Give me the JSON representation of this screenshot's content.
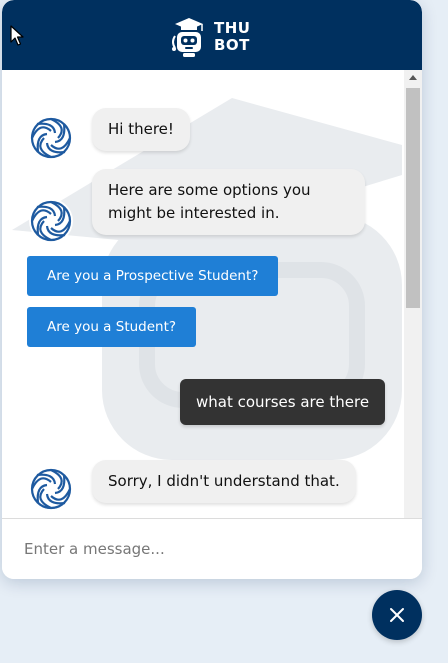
{
  "brand": {
    "logo_line1": "THU",
    "logo_line2": "BOT"
  },
  "messages": [
    {
      "sender": "bot",
      "text": "Hi there!"
    },
    {
      "sender": "bot",
      "text": "Here are some options you might be interested in."
    },
    {
      "sender": "bot",
      "text": "Sorry, I didn't understand that."
    }
  ],
  "user_messages": [
    {
      "sender": "user",
      "text": "what courses are there"
    }
  ],
  "quick_replies": [
    {
      "label": "Are you a Prospective Student?"
    },
    {
      "label": "Are you a Student?"
    }
  ],
  "composer": {
    "placeholder": "Enter a message..."
  },
  "icons": {
    "avatar": "bot-avatar-icon",
    "close": "close-icon",
    "cursor": "mouse-pointer-icon",
    "scroll_up": "scroll-up-arrow-icon"
  },
  "colors": {
    "header": "#00305f",
    "button": "#1f7fd6",
    "user_bubble": "#333333",
    "bot_bubble": "#f0f0f0"
  }
}
